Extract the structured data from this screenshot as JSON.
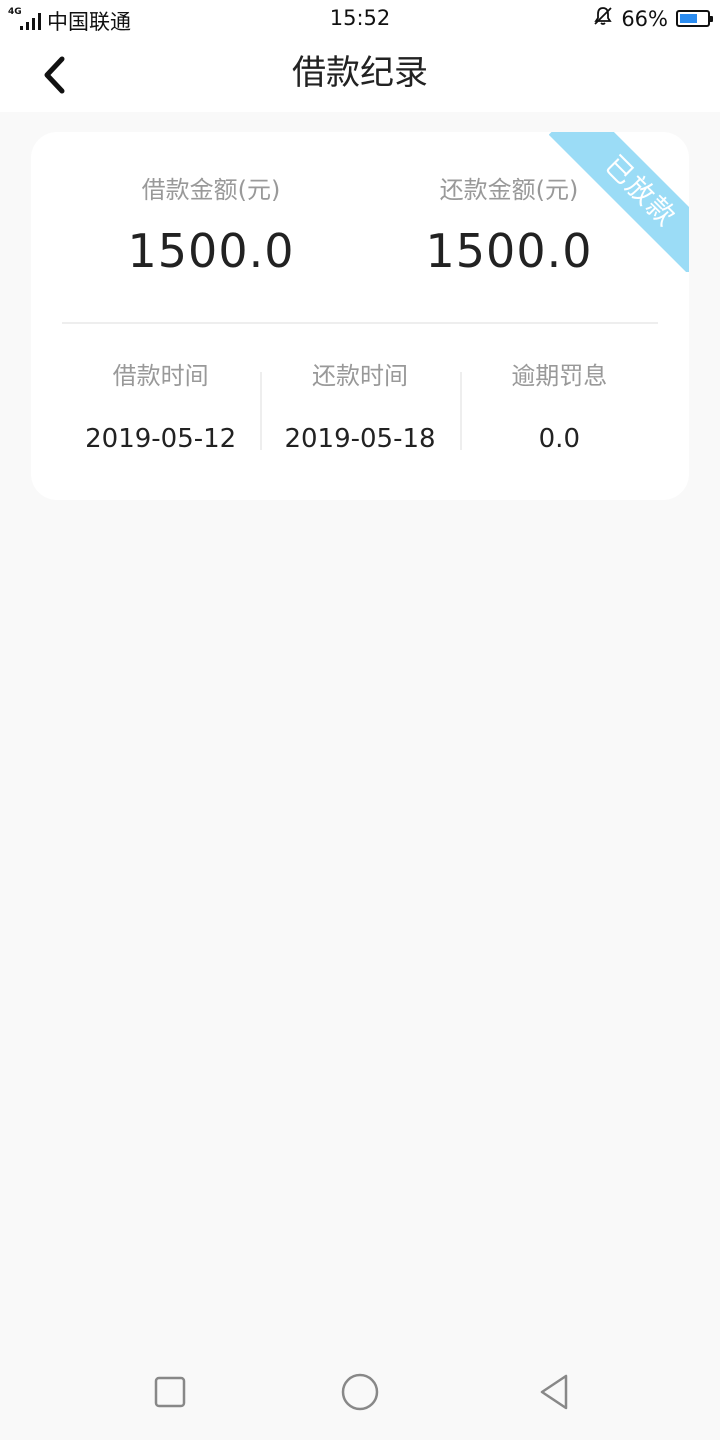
{
  "status_bar": {
    "network": "4G",
    "carrier": "中国联通",
    "time": "15:52",
    "battery": "66%",
    "battery_level": 0.66
  },
  "header": {
    "title": "借款纪录"
  },
  "record": {
    "status_ribbon": "已放款",
    "loan_amount_label": "借款金额(元)",
    "loan_amount": "1500.0",
    "repay_amount_label": "还款金额(元)",
    "repay_amount": "1500.0",
    "loan_time_label": "借款时间",
    "loan_time": "2019-05-12",
    "repay_time_label": "还款时间",
    "repay_time": "2019-05-18",
    "overdue_label": "逾期罚息",
    "overdue": "0.0"
  },
  "colors": {
    "ribbon": "#9bdcf6",
    "battery": "#2b8cf0",
    "background": "#f9f9f9"
  },
  "icons": {
    "back": "chevron-left-icon",
    "recent": "square-icon",
    "home": "circle-icon",
    "back_nav": "triangle-left-icon",
    "mute": "bell-off-icon"
  }
}
